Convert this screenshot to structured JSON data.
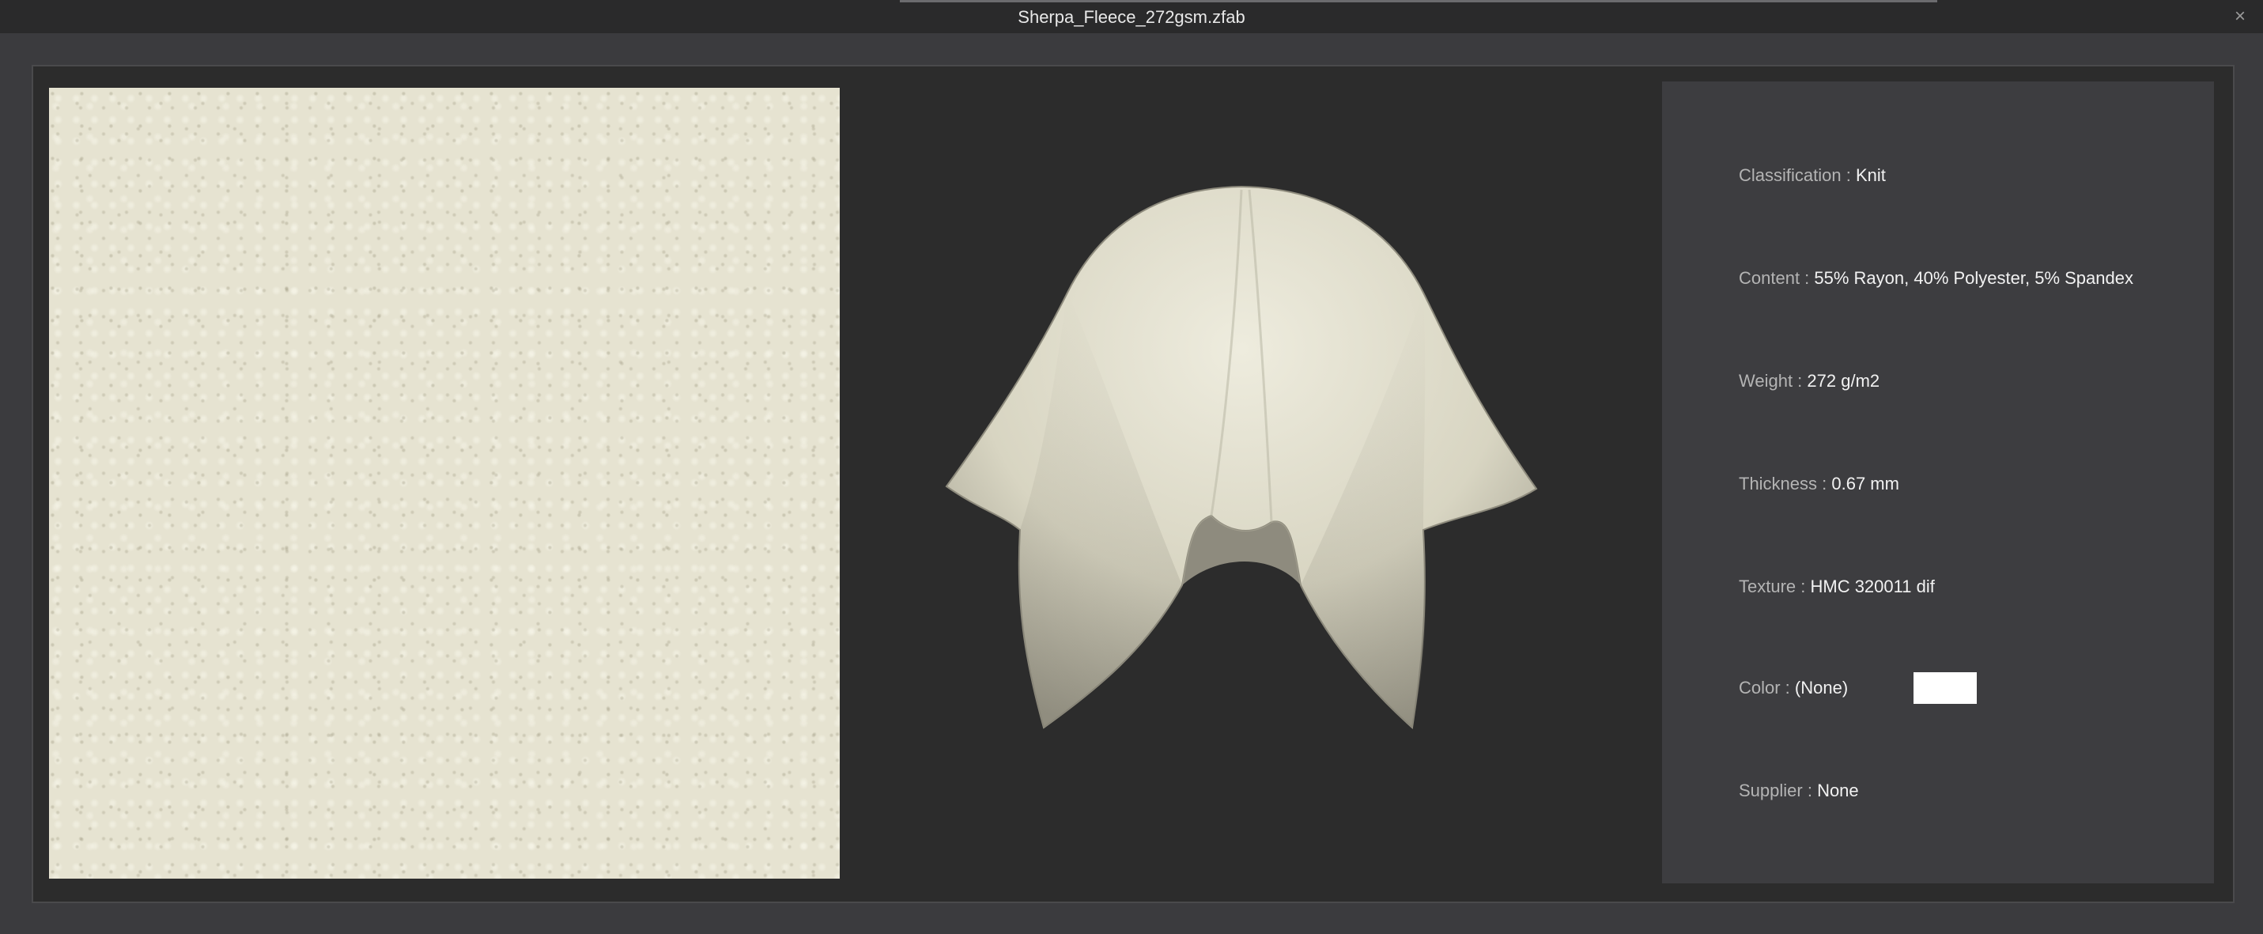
{
  "window": {
    "title": "Sherpa_Fleece_272gsm.zfab",
    "close_glyph": "×"
  },
  "fabric_info": {
    "classification": {
      "label": "Classification : ",
      "value": "Knit"
    },
    "content": {
      "label": "Content : ",
      "value": "55% Rayon, 40% Polyester, 5% Spandex"
    },
    "weight": {
      "label": "Weight : ",
      "value": "272 g/m2"
    },
    "thickness": {
      "label": "Thickness : ",
      "value": "0.67 mm"
    },
    "texture": {
      "label": "Texture : ",
      "value": "HMC 320011 dif"
    },
    "color": {
      "label": "Color : ",
      "value": "(None)",
      "swatch_color": "#ffffff"
    },
    "supplier": {
      "label": "Supplier : ",
      "value": "None"
    }
  },
  "theme": {
    "fabric_color": "#e6e3d1",
    "background": "#2c2c2c",
    "panel": "#3d3d40"
  }
}
